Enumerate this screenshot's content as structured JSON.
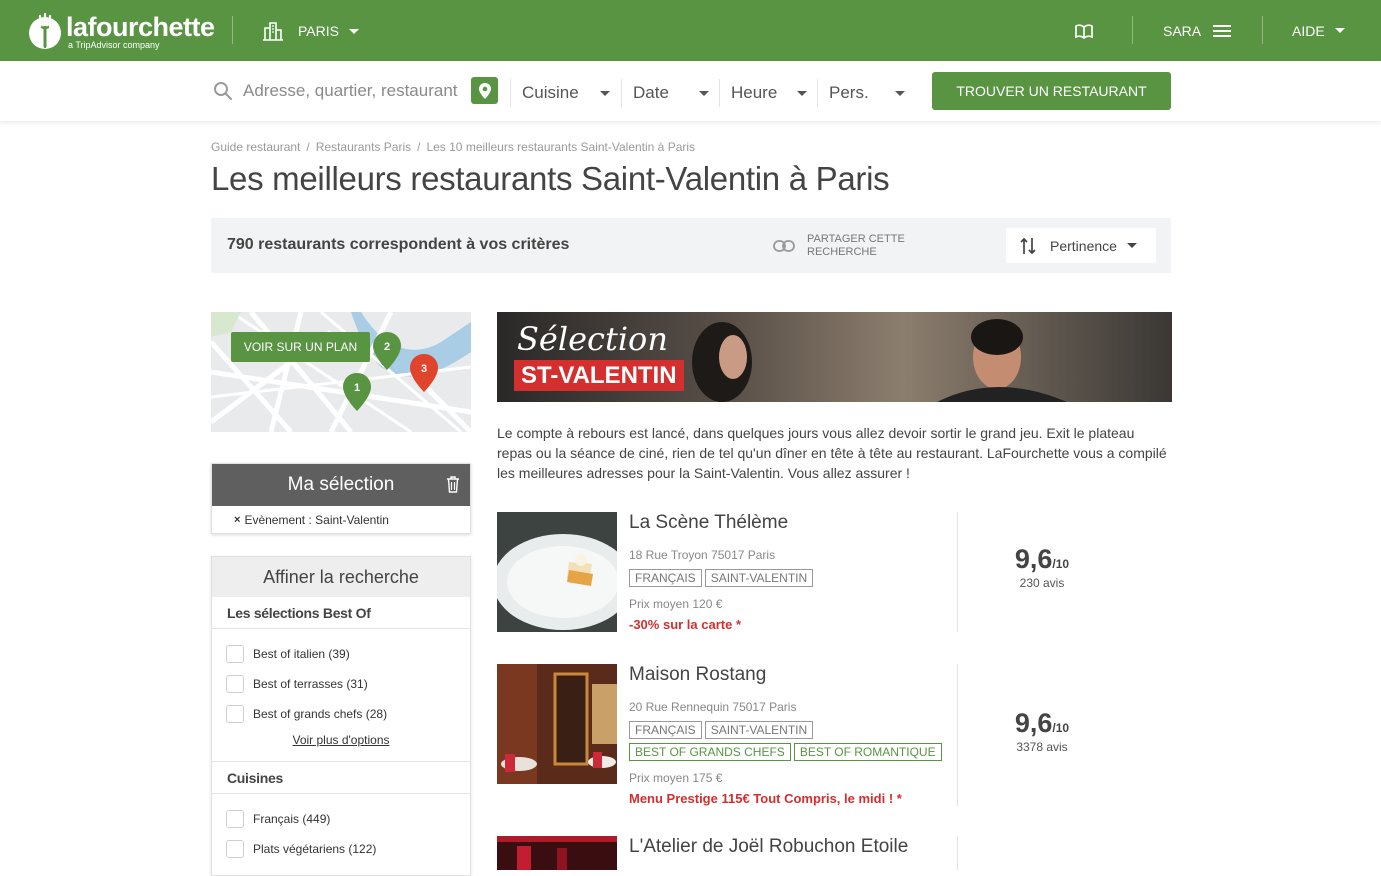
{
  "brand": {
    "name": "lafourchette",
    "subtitle": "a TripAdvisor company",
    "color": "#589442"
  },
  "topnav": {
    "city": "PARIS",
    "user": "SARA",
    "help": "AIDE"
  },
  "search": {
    "placeholder": "Adresse, quartier, restaurant",
    "cuisine": "Cuisine",
    "date": "Date",
    "time": "Heure",
    "persons": "Pers.",
    "submit": "TROUVER UN RESTAURANT"
  },
  "breadcrumb": [
    "Guide restaurant",
    "Restaurants Paris",
    "Les 10 meilleurs restaurants Saint-Valentin à Paris"
  ],
  "page_title": "Les meilleurs restaurants Saint-Valentin à Paris",
  "results": {
    "count_text": "790 restaurants correspondent à vos critères",
    "share_label": "PARTAGER CETTE RECHERCHE",
    "sort_label": "Pertinence"
  },
  "map": {
    "button": "VOIR SUR UN PLAN",
    "pins": [
      "1",
      "2",
      "3"
    ]
  },
  "selection": {
    "title": "Ma sélection",
    "filter_key": "Evènement",
    "filter_value": "Saint-Valentin"
  },
  "refine": {
    "title": "Affiner la recherche",
    "best_of_title": "Les sélections Best Of",
    "best_of": [
      {
        "label": "Best of italien (39)"
      },
      {
        "label": "Best of terrasses (31)"
      },
      {
        "label": "Best of grands chefs (28)"
      }
    ],
    "more_options": "Voir plus d'options",
    "cuisines_title": "Cuisines",
    "cuisines": [
      {
        "label": "Français (449)"
      },
      {
        "label": "Plats végétariens (122)"
      }
    ]
  },
  "banner": {
    "selection": "Sélection",
    "tag": "ST-VALENTIN"
  },
  "intro": "Le compte à rebours est lancé, dans quelques jours vous allez devoir sortir le grand jeu. Exit le plateau repas ou la séance de ciné, rien de tel qu'un dîner en tête à tête au restaurant. LaFourchette vous a compilé les meilleures adresses pour la Saint-Valentin. Vous allez assurer !",
  "restaurants": [
    {
      "name": "La Scène Thélème",
      "address": "18 Rue Troyon 75017 Paris",
      "tags": [
        "FRANÇAIS",
        "SAINT-VALENTIN"
      ],
      "green_tags": [],
      "price": "Prix moyen 120 €",
      "offer": "-30% sur la carte *",
      "rating": "9,6",
      "rating_scale": "/10",
      "reviews": "230 avis"
    },
    {
      "name": "Maison Rostang",
      "address": "20 Rue Rennequin 75017 Paris",
      "tags": [
        "FRANÇAIS",
        "SAINT-VALENTIN"
      ],
      "green_tags": [
        "BEST OF GRANDS CHEFS",
        "BEST OF ROMANTIQUE"
      ],
      "price": "Prix moyen 175 €",
      "offer": "Menu Prestige 115€ Tout Compris, le midi ! *",
      "rating": "9,6",
      "rating_scale": "/10",
      "reviews": "3378 avis"
    },
    {
      "name": "L'Atelier de Joël Robuchon Etoile"
    }
  ]
}
